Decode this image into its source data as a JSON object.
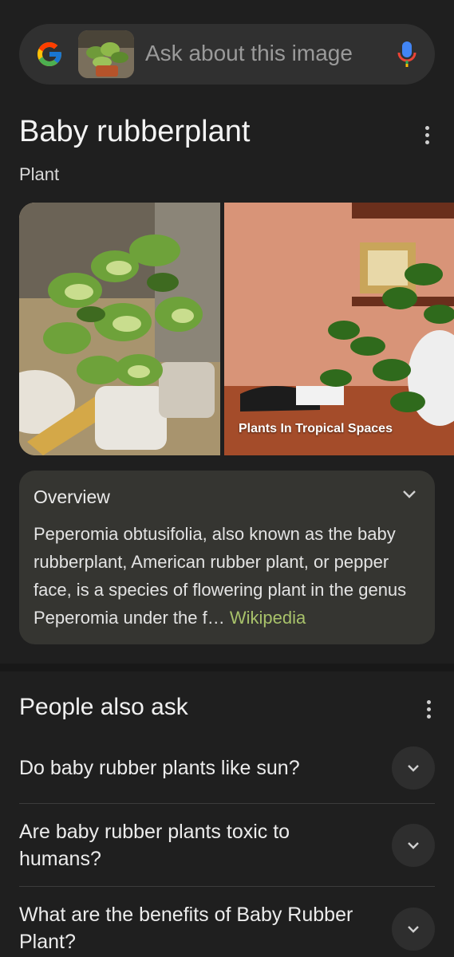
{
  "search": {
    "placeholder": "Ask about this image"
  },
  "result": {
    "title": "Baby rubberplant",
    "subtitle": "Plant"
  },
  "images": [
    {
      "caption": ""
    },
    {
      "caption": "Plants In Tropical Spaces"
    }
  ],
  "overview": {
    "title": "Overview",
    "text": "Peperomia obtusifolia, also known as the baby rubberplant, American rubber plant, or pepper face, is a species of flowering plant in the genus Peperomia under the f…",
    "source": "Wikipedia"
  },
  "people_also_ask": {
    "title": "People also ask",
    "questions": [
      "Do baby rubber plants like sun?",
      "Are baby rubber plants toxic to humans?",
      "What are the benefits of Baby Rubber Plant?"
    ]
  },
  "colors": {
    "background": "#1f1f1f",
    "card": "#353531",
    "link": "#a8c26a"
  }
}
